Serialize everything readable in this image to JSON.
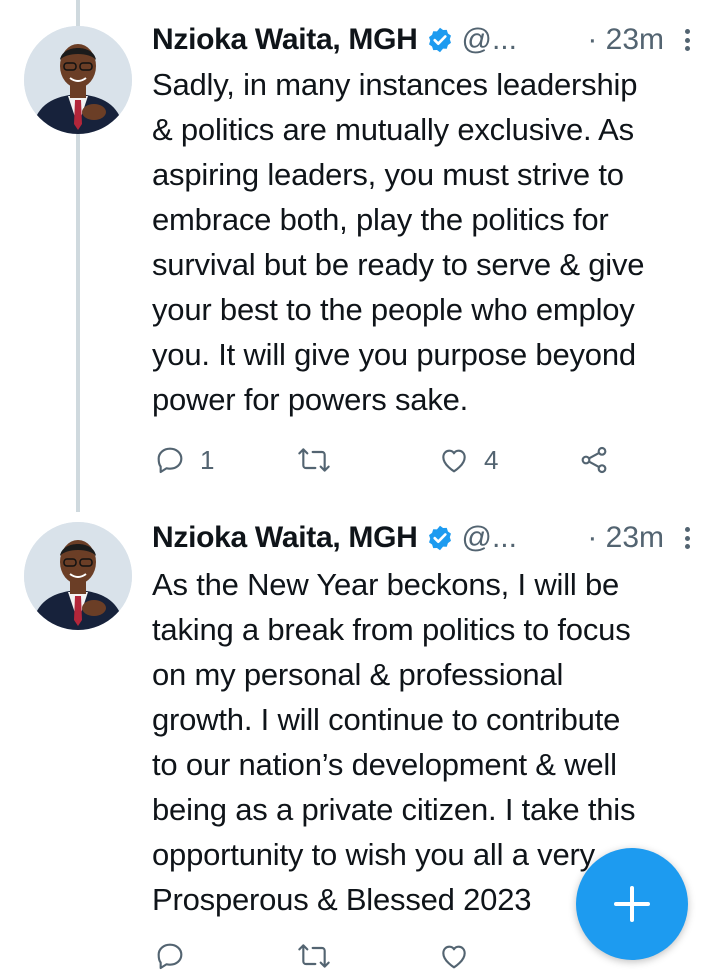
{
  "tweets": [
    {
      "author": {
        "name": "Nzioka Waita, MGH",
        "handle": "@...",
        "verified": true
      },
      "time": "· 23m",
      "text": "Sadly, in many instances leadership\n& politics are mutually exclusive. As\naspiring leaders, you must strive to\nembrace both, play the politics for\nsurvival but be ready to serve & give\nyour best to the people who employ\nyou. It will give you purpose beyond\npower for powers sake.",
      "actions": {
        "replies": "1",
        "retweets": "",
        "likes": "4"
      }
    },
    {
      "author": {
        "name": "Nzioka Waita, MGH",
        "handle": "@...",
        "verified": true
      },
      "time": "· 23m",
      "text": "As the New Year beckons, I will be\ntaking a break from politics to focus\non my personal & professional\ngrowth. I will continue to contribute\nto our nation’s development & well\nbeing as a private citizen. I take this\nopportunity to wish you all a very\nProsperous & Blessed 2023",
      "actions": {
        "replies": "",
        "retweets": "",
        "likes": ""
      }
    }
  ],
  "icons": [
    "reply-icon",
    "retweet-icon",
    "like-icon",
    "share-icon",
    "verified-badge-icon",
    "more-options-icon",
    "compose-plus-icon"
  ],
  "colors": {
    "accent": "#1d9bf0",
    "text": "#0f1419",
    "muted": "#536471",
    "thread_line": "#cfd9de"
  }
}
